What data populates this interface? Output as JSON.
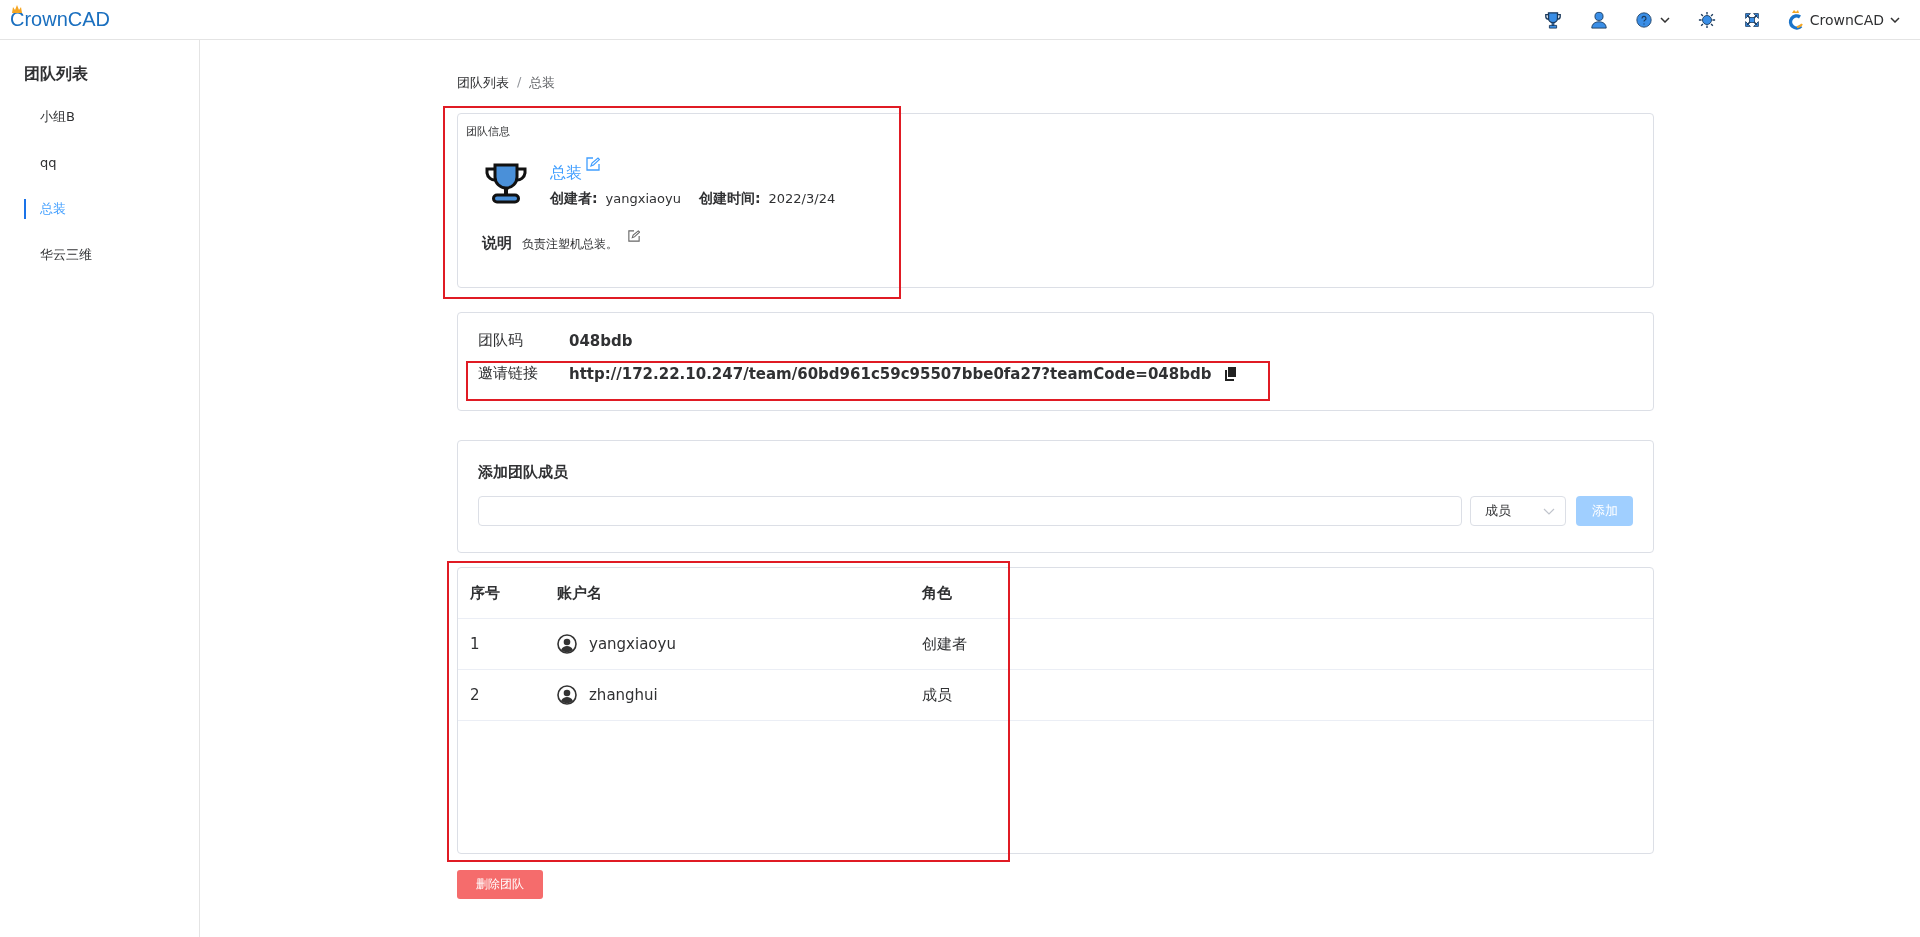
{
  "header": {
    "logo": "CrownCAD",
    "user": "CrownCAD"
  },
  "sidebar": {
    "title": "团队列表",
    "items": [
      {
        "label": "小组B",
        "selected": false
      },
      {
        "label": "qq",
        "selected": false
      },
      {
        "label": "总装",
        "selected": true
      },
      {
        "label": "华云三维",
        "selected": false
      }
    ]
  },
  "breadcrumb": [
    "团队列表",
    "总装"
  ],
  "breadcrumb_separator": "/",
  "team_info": {
    "highlighted": true,
    "section_title": "团队信息",
    "name": "总装",
    "creator_label": "创建者:",
    "creator": "yangxiaoyu",
    "created_label": "创建时间:",
    "created": "2022/3/24",
    "description_label": "说明",
    "description": "负责注塑机总装。"
  },
  "team_code": {
    "code_label": "团队码",
    "code": "048bdb",
    "link_label": "邀请链接",
    "link": "http://172.22.10.247/team/60bd961c59c95507bbe0fa27?teamCode=048bdb",
    "link_highlighted": true
  },
  "add_member": {
    "title": "添加团队成员",
    "role": "成员",
    "add_button": "添加",
    "add_disabled": true
  },
  "members": {
    "highlighted": true,
    "columns": [
      "序号",
      "账户名",
      "角色"
    ],
    "rows": [
      {
        "index": "1",
        "account": "yangxiaoyu",
        "role": "创建者"
      },
      {
        "index": "2",
        "account": "zhanghui",
        "role": "成员"
      }
    ]
  },
  "delete_button": "删除团队"
}
